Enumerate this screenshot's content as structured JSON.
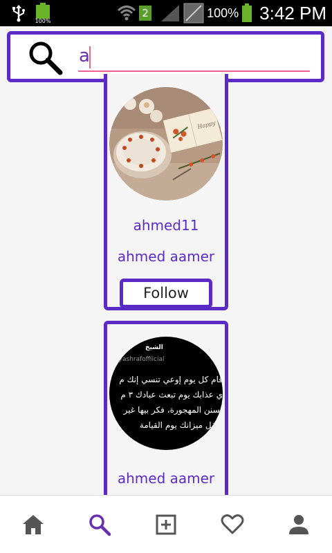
{
  "status_bar": {
    "battery_small_text": "100%",
    "sim_number": "2",
    "battery_percent": "100%",
    "time": "3:42 PM"
  },
  "search": {
    "value": "a",
    "placeholder": ""
  },
  "results": [
    {
      "username": "ahmed11",
      "full_name": "ahmed aamer",
      "follow_label": "Follow",
      "avatar": "food-photo"
    },
    {
      "full_name": "ahmed aamer",
      "avatar": "arabic-text-post",
      "avatar_text": {
        "handle": "@ashrafoffiicial",
        "top_word": "الشيخ",
        "lines": [
          "قام كل يوم إوعي تنسي إنك م",
          "ي عذابك يوم تبعث عبادك ٣ م",
          "لسنن المهجورة، فكر بيها غير",
          "هتقل ميزانك يوم القيامة"
        ]
      }
    }
  ],
  "bottom_nav": [
    {
      "icon": "home-icon",
      "active": false
    },
    {
      "icon": "search-icon",
      "active": true
    },
    {
      "icon": "add-box-icon",
      "active": false
    },
    {
      "icon": "heart-icon",
      "active": false
    },
    {
      "icon": "profile-icon",
      "active": false
    }
  ],
  "colors": {
    "accent": "#5b2bc8",
    "input_underline": "#f06292",
    "nav_inactive": "#555555"
  }
}
